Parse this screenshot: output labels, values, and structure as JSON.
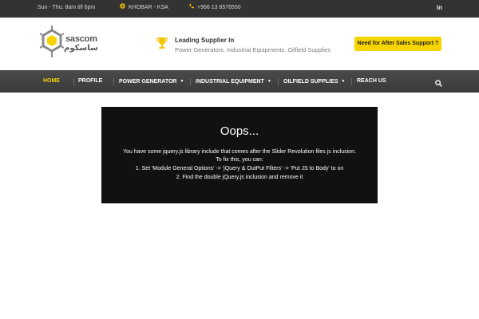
{
  "topbar": {
    "hours": "Sun - Thu: 8am till 6pm",
    "location": "KHOBAR - KSA",
    "phone": "+966 13 8576550",
    "social": "in",
    "location_icon": "globe-icon",
    "phone_icon": "phone-icon",
    "social_icon": "linkedin-icon"
  },
  "header": {
    "logo_text": "sascom",
    "logo_arabic": "ساسكوم",
    "tagline_title": "Leading Supplier In",
    "tagline_sub": "Power Generators, Industrial Equipments, Oilfield Supplies",
    "support_button": "Need for After Sales Support ?",
    "accent_color": "#f6d400"
  },
  "nav": {
    "items": [
      {
        "label": "HOME",
        "active": true
      },
      {
        "label": "PROFILE",
        "active": false
      },
      {
        "label": "POWER GENERATOR",
        "active": false,
        "dropdown": true
      },
      {
        "label": "INDUSTRIAL EQUIPMENT",
        "active": false,
        "dropdown": true
      },
      {
        "label": "OILFIELD SUPPLIES",
        "active": false,
        "dropdown": true
      },
      {
        "label": "REACH US",
        "active": false
      }
    ],
    "caret": "▼",
    "search_icon": "search-icon"
  },
  "error": {
    "title": "Oops...",
    "line1": "You have some jquery.js library include that comes after the Slider Revolution files js inclusion.",
    "line2": "To fix this, you can:",
    "line3": "1. Set 'Module General Options' -> 'jQuery & OutPut Filters' -> 'Put JS to Body' to on",
    "line4": "2. Find the double jQuery.js inclusion and remove it"
  }
}
